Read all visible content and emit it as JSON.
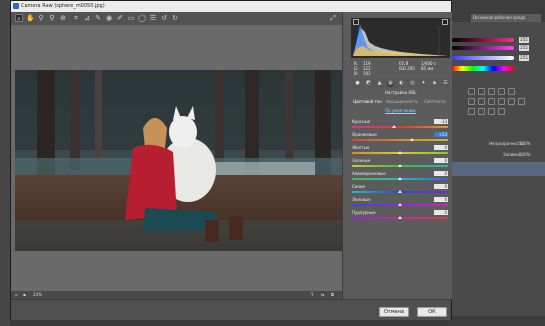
{
  "window": {
    "title": "Camera Raw (sphere_m0050.jpg)"
  },
  "photoshop": {
    "workspace_label": "Основная рабочая среда",
    "slider_values": [
      "255",
      "255",
      "255"
    ],
    "layers": {
      "opacity_label": "Непрозрачность:",
      "opacity_value": "100%",
      "fill_label": "Заливка:",
      "fill_value": "100%"
    }
  },
  "tools": [
    "zoom-tool",
    "hand-tool",
    "white-balance-tool",
    "color-sampler-tool",
    "targeted-adjustment-tool",
    "crop-tool",
    "straighten-tool",
    "spot-removal-tool",
    "red-eye-tool",
    "adjustment-brush-tool",
    "graduated-filter-tool",
    "radial-filter-tool",
    "preferences-tool",
    "rotate-left-tool",
    "rotate-right-tool"
  ],
  "info": {
    "r_label": "R:",
    "g_label": "G:",
    "b_label": "B:",
    "r": "119",
    "g": "122",
    "b": "102",
    "f_value": "f/2,8",
    "shutter": "1/400 с",
    "iso": "ISO 200",
    "focal": "85 мм"
  },
  "panel": {
    "heading": "Настройка HSL",
    "subtabs": [
      "Цветовой тон",
      "Насыщенность",
      "Светлость"
    ],
    "default_link": "По умолчанию",
    "sliders": [
      {
        "label": "Красные",
        "value": "-13",
        "pos": 0.44,
        "colors": [
          "#c83f8f",
          "#d83a3a",
          "#d89a2a"
        ]
      },
      {
        "label": "Оранжевые",
        "value": "+23",
        "pos": 0.62,
        "colors": [
          "#c84a3a",
          "#d88a2a",
          "#c8b82a"
        ],
        "selected": true
      },
      {
        "label": "Желтые",
        "value": "0",
        "pos": 0.5,
        "colors": [
          "#d88a2a",
          "#d8c82a",
          "#8ac82a"
        ]
      },
      {
        "label": "Зеленые",
        "value": "0",
        "pos": 0.5,
        "colors": [
          "#c8c82a",
          "#4ab84a",
          "#2ab8a8"
        ]
      },
      {
        "label": "Аквамариновые",
        "value": "0",
        "pos": 0.5,
        "colors": [
          "#4ab84a",
          "#2ab8b8",
          "#2a6ad8"
        ]
      },
      {
        "label": "Синие",
        "value": "0",
        "pos": 0.5,
        "colors": [
          "#2ab8c8",
          "#2a4ad8",
          "#7a2ad8"
        ]
      },
      {
        "label": "Лиловые",
        "value": "0",
        "pos": 0.5,
        "colors": [
          "#3a4ad8",
          "#8a2ad8",
          "#c82ab8"
        ]
      },
      {
        "label": "Пурпурные",
        "value": "0",
        "pos": 0.5,
        "colors": [
          "#8a2ad8",
          "#c82a9a",
          "#d83a4a"
        ]
      }
    ]
  },
  "status": {
    "zoom": "24%"
  },
  "buttons": {
    "cancel": "Отмена",
    "ok": "ОК"
  }
}
